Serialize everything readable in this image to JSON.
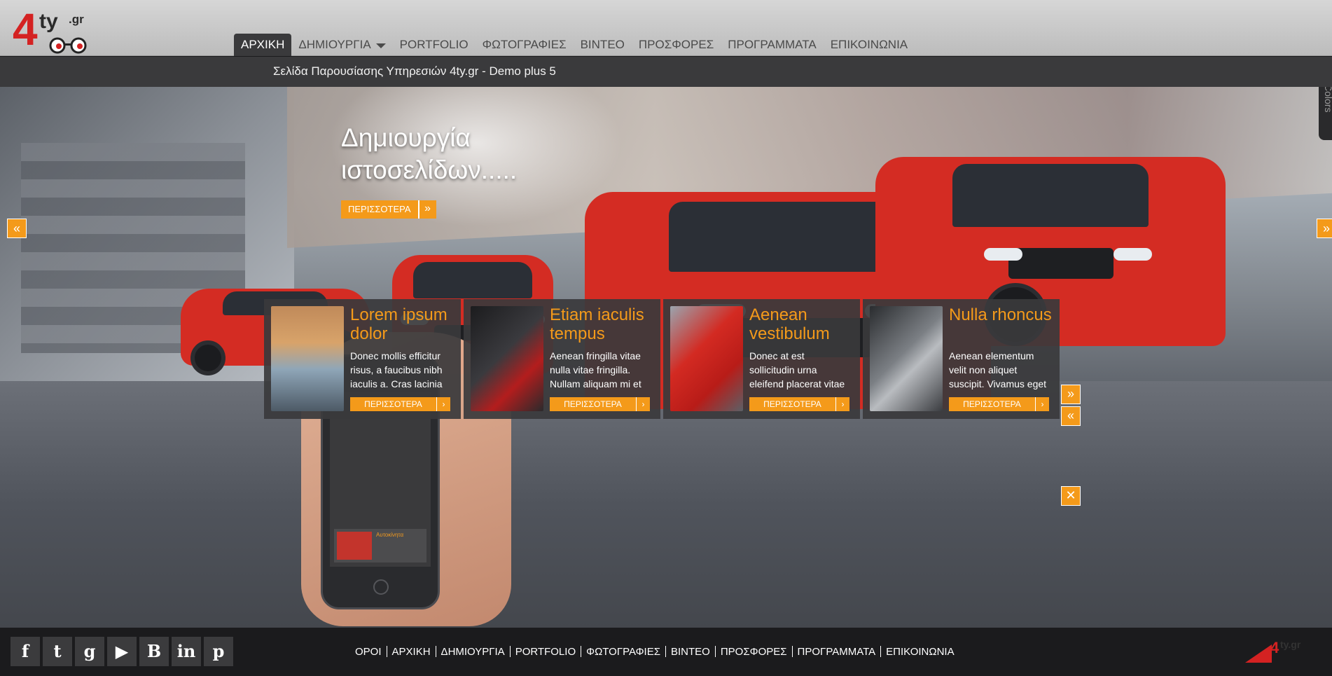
{
  "logo": {
    "main": "4",
    "sub": "ty",
    "tld": ".gr"
  },
  "nav": {
    "items": [
      {
        "label": "ΑΡΧΙΚΗ",
        "active": true
      },
      {
        "label": "ΔΗΜΙΟΥΡΓΙΑ",
        "dropdown": true
      },
      {
        "label": "PORTFOLIO"
      },
      {
        "label": "ΦΩΤΟΓΡΑΦΙΕΣ"
      },
      {
        "label": "ΒΙΝΤΕΟ"
      },
      {
        "label": "ΠΡΟΣΦΟΡΕΣ"
      },
      {
        "label": "ΠΡΟΓΡΑΜΜΑΤΑ"
      },
      {
        "label": "ΕΠΙΚΟΙΝΩΝΙΑ"
      }
    ]
  },
  "subbar": {
    "subtitle": "Σελίδα Παρουσίασης Υπηρεσιών 4ty.gr - Demo plus 5"
  },
  "hero": {
    "title_line1": "Δημιουργία",
    "title_line2": "ιστοσελίδων.....",
    "more_label": "ΠΕΡΙΣΣΟΤΕΡΑ",
    "prev_icon": "«",
    "next_icon": "»"
  },
  "phone_preview": {
    "title": "Αυτοκίνητα"
  },
  "cards": [
    {
      "title": "Lorem ipsum dolor",
      "text": "Donec mollis efficitur risus, a faucibus nibh iaculis a. Cras lacinia",
      "more": "ΠΕΡΙΣΣΟΤΕΡΑ"
    },
    {
      "title": "Etiam iaculis tempus",
      "text": "Aenean fringilla vitae nulla vitae fringilla. Nullam aliquam mi et",
      "more": "ΠΕΡΙΣΣΟΤΕΡΑ"
    },
    {
      "title": "Aenean vestibulum",
      "text": "Donec at est sollicitudin urna eleifend placerat vitae",
      "more": "ΠΕΡΙΣΣΟΤΕΡΑ"
    },
    {
      "title": "Nulla rhoncus",
      "text": "Aenean elementum velit non aliquet suscipit. Vivamus eget",
      "more": "ΠΕΡΙΣΣΟΤΕΡΑ"
    }
  ],
  "card_controls": {
    "next": "»",
    "prev": "«",
    "close": "✕"
  },
  "footer": {
    "links": [
      "ΟΡΟΙ",
      "ΑΡΧΙΚΗ",
      "ΔΗΜΙΟΥΡΓΙΑ",
      "PORTFOLIO",
      "ΦΩΤΟΓΡΑΦΙΕΣ",
      "ΒΙΝΤΕΟ",
      "ΠΡΟΣΦΟΡΕΣ",
      "ΠΡΟΓΡΑΜΜΑΤΑ",
      "ΕΠΙΚΟΙΝΩΝΙΑ"
    ],
    "social": [
      {
        "name": "facebook",
        "glyph": "f"
      },
      {
        "name": "twitter",
        "glyph": "t"
      },
      {
        "name": "google",
        "glyph": "g"
      },
      {
        "name": "youtube",
        "glyph": "▶"
      },
      {
        "name": "blogger",
        "glyph": "B"
      },
      {
        "name": "linkedin",
        "glyph": "in"
      },
      {
        "name": "pinterest",
        "glyph": "p"
      }
    ],
    "brand_main": "4",
    "brand_sub": "ty.gr"
  },
  "colors": {
    "accent": "#f49a1a",
    "brand_red": "#d42222",
    "dark": "#3a3a3c"
  }
}
